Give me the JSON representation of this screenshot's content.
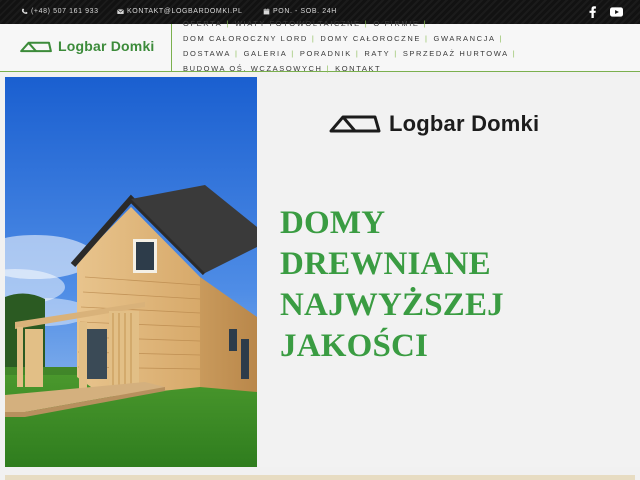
{
  "topbar": {
    "phone": "(+48) 507 161 933",
    "email": "KONTAKT@LOGBARDOMKI.PL",
    "hours": "PON. - SOB. 24H",
    "social": [
      "facebook-icon",
      "youtube-icon"
    ]
  },
  "brand": {
    "name": "Logbar Domki",
    "accent_green": "#3a9c42",
    "dark": "#151515"
  },
  "nav": {
    "row1": [
      "OFERTA",
      "WIATY FOTOWOLTAICZNE",
      "O FIRMIE",
      ""
    ],
    "row2": [
      "DOM CAŁOROCZNY LORD",
      "DOMY CAŁOROCZNE",
      "GWARANCJA",
      ""
    ],
    "row3": [
      "DOSTAWA",
      "GALERIA",
      "PORADNIK",
      "RATY",
      "SPRZEDAŻ HURTOWA",
      ""
    ],
    "row4": [
      "BUDOWA OŚ. WCZASOWYCH",
      "KONTAKT"
    ]
  },
  "hero": {
    "headline": [
      "DOMY",
      "DREWNIANE",
      "NAJWYŻSZEJ",
      "JAKOŚCI"
    ]
  }
}
